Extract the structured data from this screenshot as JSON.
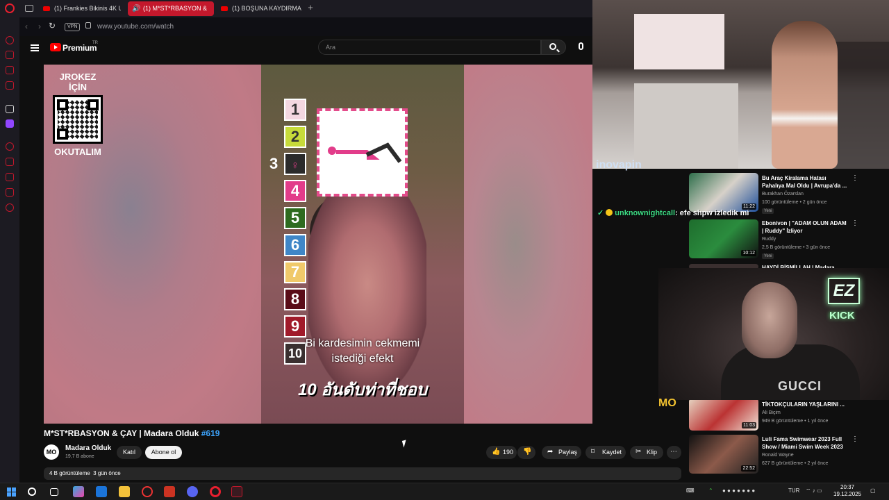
{
  "browser": {
    "tabs": [
      {
        "label": "(1) Frankies Bikinis 4K UH",
        "active": false
      },
      {
        "label": "(1) M*ST*RBASYON &",
        "active": true
      },
      {
        "label": "(1) BOŞUNA KAYDIRMA 5",
        "active": false
      }
    ],
    "vpn_label": "VPN",
    "url": "www.youtube.com/watch"
  },
  "youtube": {
    "brand": "Premium",
    "brand_region": "TR",
    "search_placeholder": "Ara"
  },
  "video": {
    "qr_title": "JROKEZ İÇİN",
    "qr_footer": "OKUTALIM",
    "numbers": [
      "1",
      "2",
      "3",
      "4",
      "5",
      "6",
      "7",
      "8",
      "9",
      "10"
    ],
    "side_number": "3",
    "subtitle_line1": "Bi kardesimin cekmemi",
    "subtitle_line2": "istediği efekt",
    "thai_caption": "10 อันดับท่าที่ชอบ",
    "watermark": "MO"
  },
  "video_info": {
    "title": "M*ST*RBASYON & ÇAY | Madara Olduk",
    "hashtag": "#619",
    "channel_avatar": "MO",
    "channel_name": "Madara Olduk",
    "subscribers": "19,7 B abone",
    "join_label": "Katıl",
    "subscribe_label": "Abone ol",
    "likes": "190",
    "share_label": "Paylaş",
    "save_label": "Kaydet",
    "clip_label": "Klip",
    "desc_views": "4 B görüntüleme",
    "desc_date": "3 gün önce"
  },
  "stream_overlay": {
    "chat_brand": "inovapin",
    "chat_user": "unknownightcall",
    "chat_message": ": efe shpw izledik mi",
    "cam_logo_ez": "EZ",
    "cam_logo_kick": "KICK",
    "shirt_text": "GUCCI",
    "corner_badge": "MO"
  },
  "recommendations": [
    {
      "title": "Bu Araç Kiralama Hatası Pahalıya Mal Oldu | Avrupa'da ...",
      "channel": "Burakhan Özarslan",
      "meta": "100 görüntüleme • 2 gün önce",
      "duration": "11:22",
      "new": "Yeni"
    },
    {
      "title": "Ebonivon | \"ADAM OLUN ADAM | Ruddy\" İzliyor",
      "channel": "Ruddy",
      "meta": "2,5 B görüntüleme • 3 gün önce",
      "duration": "10:12",
      "new": "Yeni"
    },
    {
      "title": "HAYDİ BİSMİLLAH | Madara ...",
      "channel": "",
      "meta": "",
      "duration": "",
      "new": ""
    },
    {
      "title": "TİKTOKÇULARIN YAŞLARINI ...",
      "channel": "Ali Biçim",
      "meta": "949 B görüntüleme • 1 yıl önce",
      "duration": "11:03",
      "new": ""
    },
    {
      "title": "Luli Fama Swimwear 2023 Full Show / Miami Swim Week 2023",
      "channel": "Ronald Wayne",
      "meta": "627 B görüntüleme • 2 yıl önce",
      "duration": "22:52",
      "new": ""
    }
  ],
  "taskbar": {
    "lang": "TUR",
    "time": "20:37",
    "date": "19.12.2025"
  },
  "colors": {
    "accent": "#c4182c",
    "youtube_red": "#ff0000",
    "hashtag": "#3ea6ff"
  }
}
